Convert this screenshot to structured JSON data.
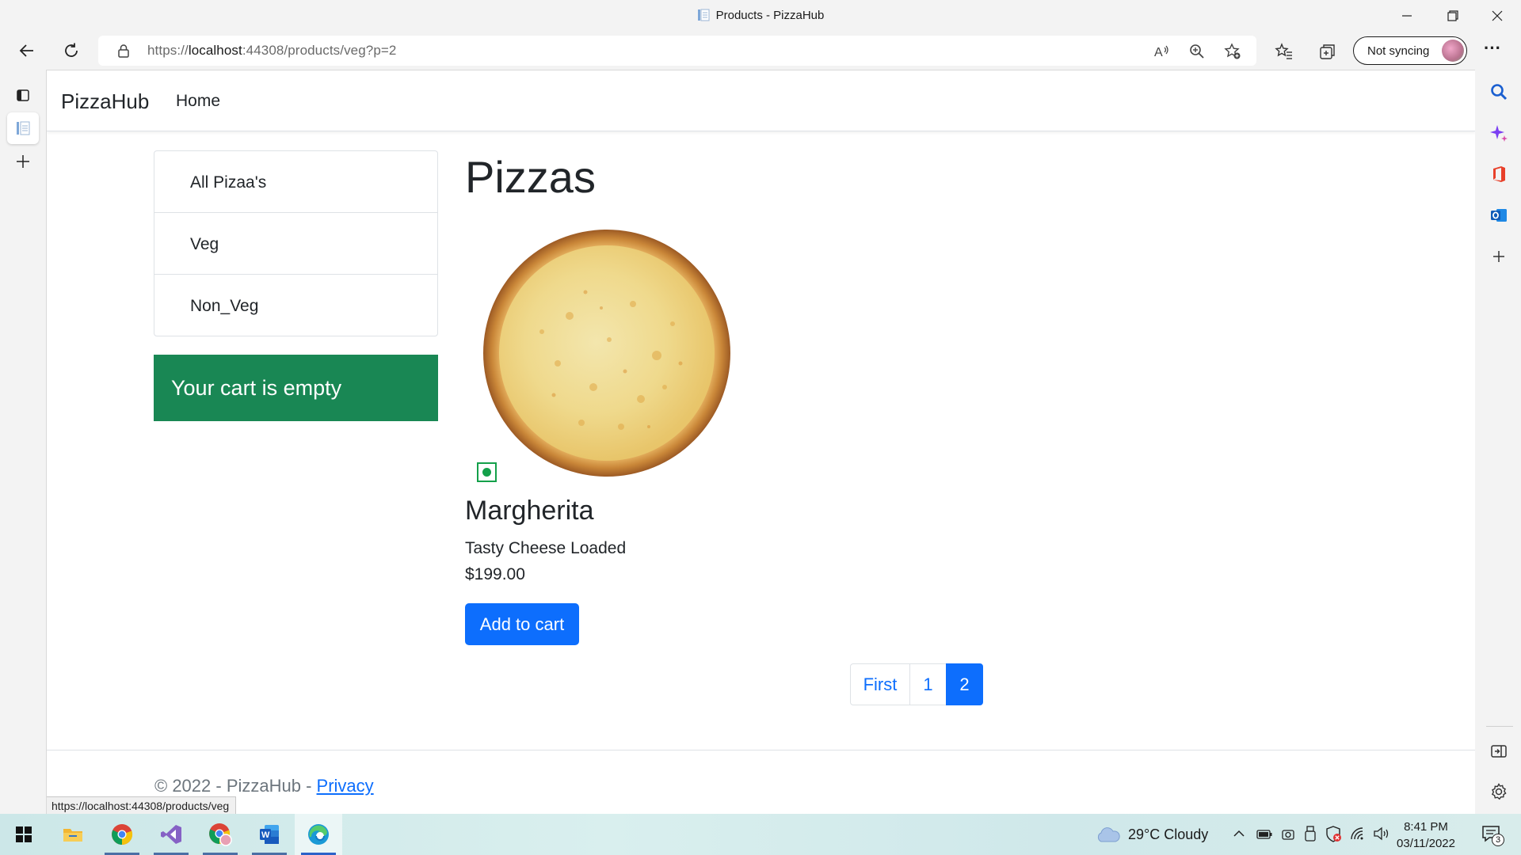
{
  "window": {
    "title": "Products - PizzaHub"
  },
  "browser": {
    "url_prefix": "https://",
    "url_host": "localhost",
    "url_rest": ":44308/products/veg?p=2",
    "sync_label": "Not syncing",
    "status_url": "https://localhost:44308/products/veg"
  },
  "site": {
    "brand": "PizzaHub",
    "nav_home": "Home",
    "categories": [
      {
        "label": "All Pizaa's"
      },
      {
        "label": "Veg"
      },
      {
        "label": "Non_Veg"
      }
    ],
    "cart_message": "Your cart is empty",
    "page_title": "Pizzas",
    "product": {
      "name": "Margherita",
      "description": "Tasty Cheese Loaded",
      "price": "$199.00",
      "add_button": "Add to cart"
    },
    "pagination": {
      "first": "First",
      "pages": [
        "1",
        "2"
      ],
      "current": "2"
    },
    "footer": {
      "text": "© 2022 - PizzaHub - ",
      "privacy": "Privacy"
    }
  },
  "taskbar": {
    "weather": "29°C  Cloudy",
    "time": "8:41 PM",
    "date": "03/11/2022",
    "notification_count": "3"
  },
  "colors": {
    "primary": "#0d6efd",
    "success": "#198754",
    "veg_mark": "#14a04a"
  }
}
